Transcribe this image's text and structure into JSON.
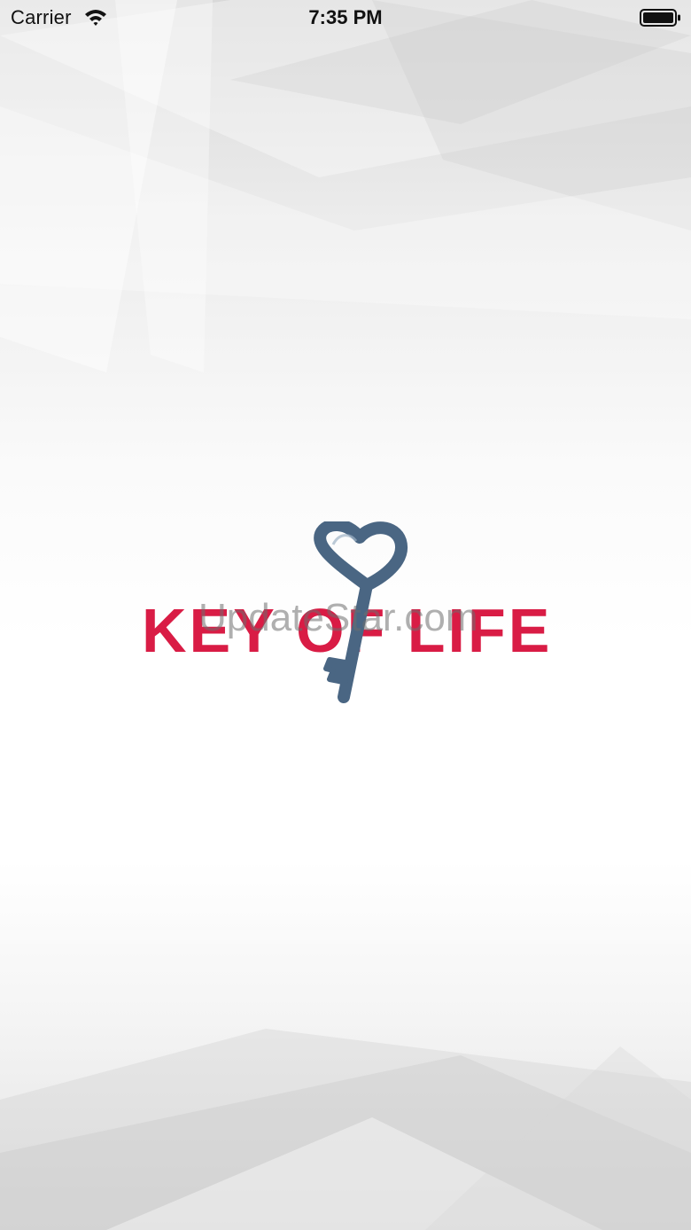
{
  "status_bar": {
    "carrier": "Carrier",
    "time": "7:35 PM",
    "wifi_icon": "wifi-icon",
    "battery_icon": "battery-icon"
  },
  "splash": {
    "logo_text": "KEY OF LIFE",
    "logo_icon": "heart-key-icon",
    "brand_color": "#d91c45",
    "key_color": "#4a6683"
  },
  "watermark": {
    "text": "UpdateStar.com"
  }
}
